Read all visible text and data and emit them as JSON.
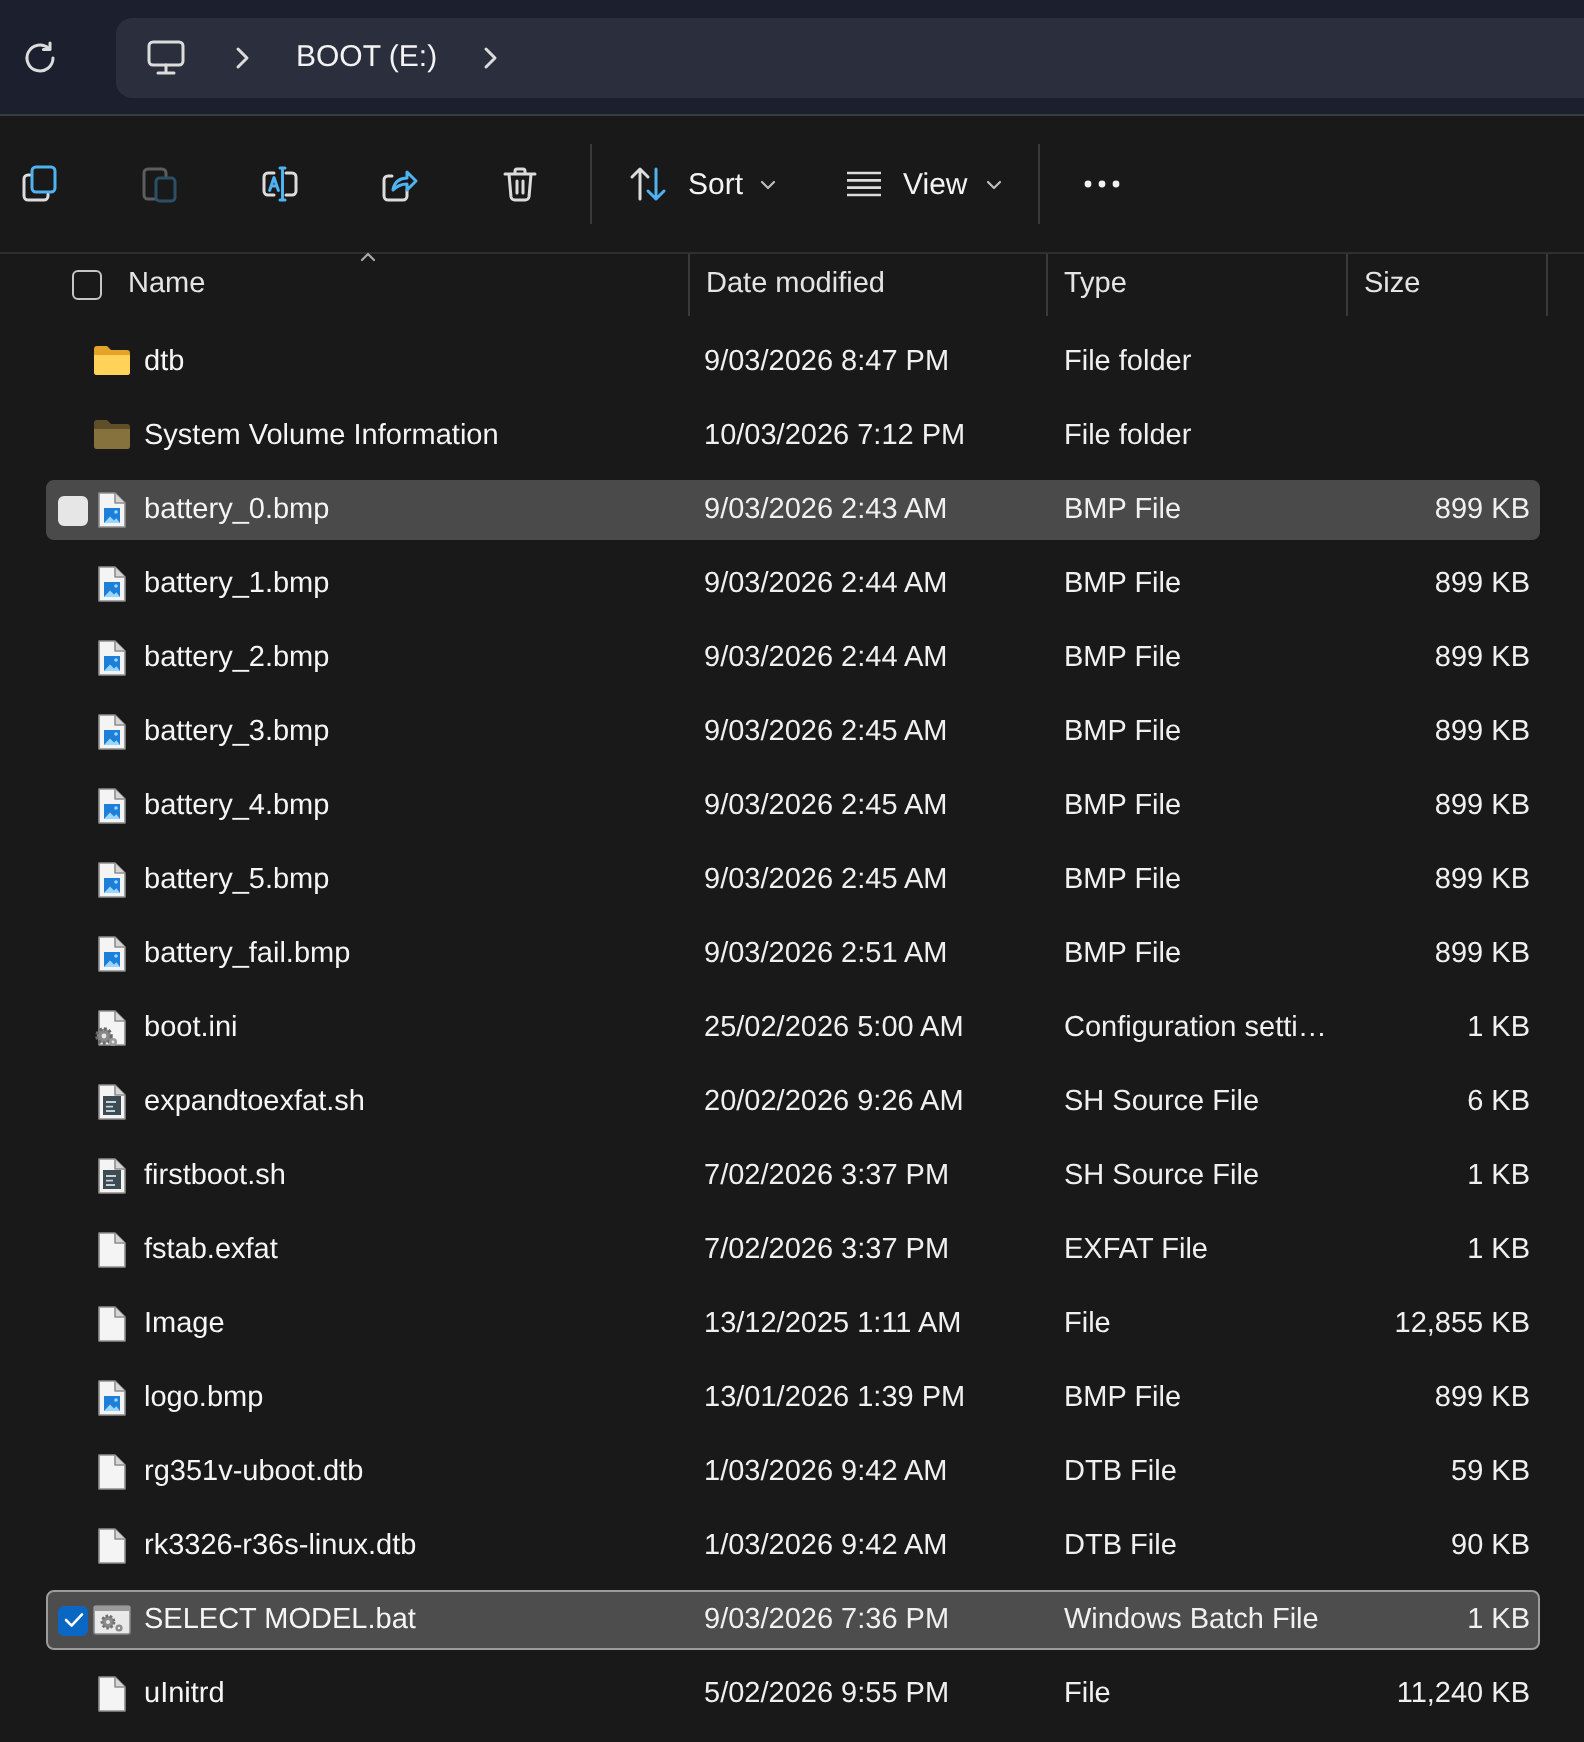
{
  "address_bar": {
    "segments": [
      "BOOT (E:)"
    ]
  },
  "toolbar": {
    "buttons": [
      {
        "kind": "copy",
        "disabled": false
      },
      {
        "kind": "paste",
        "disabled": true
      },
      {
        "kind": "rename",
        "disabled": false
      },
      {
        "kind": "share",
        "disabled": false
      },
      {
        "kind": "delete",
        "disabled": false
      }
    ],
    "menus": [
      {
        "kind": "sort",
        "label": "Sort"
      },
      {
        "kind": "view",
        "label": "View"
      }
    ]
  },
  "file_list": {
    "select_all": {
      "checked": false
    },
    "columns": [
      {
        "label": "Name",
        "sorted": true
      },
      {
        "label": "Date modified",
        "sorted": false
      },
      {
        "label": "Type",
        "sorted": false
      },
      {
        "label": "Size",
        "sorted": false
      }
    ],
    "rows": [
      {
        "kind": "folder",
        "name": "dtb",
        "date_modified": "9/03/2026 8:47 PM",
        "type": "File folder",
        "selected": false,
        "hovered": false
      },
      {
        "kind": "hidden-folder",
        "name": "System Volume Information",
        "date_modified": "10/03/2026 7:12 PM",
        "type": "File folder",
        "selected": false,
        "hovered": false
      },
      {
        "kind": "image",
        "name": "battery_0.bmp",
        "date_modified": "9/03/2026 2:43 AM",
        "type": "BMP File",
        "size": "899 KB",
        "selected": false,
        "hovered": true
      },
      {
        "kind": "image",
        "name": "battery_1.bmp",
        "date_modified": "9/03/2026 2:44 AM",
        "type": "BMP File",
        "size": "899 KB",
        "selected": false,
        "hovered": false
      },
      {
        "kind": "image",
        "name": "battery_2.bmp",
        "date_modified": "9/03/2026 2:44 AM",
        "type": "BMP File",
        "size": "899 KB",
        "selected": false,
        "hovered": false
      },
      {
        "kind": "image",
        "name": "battery_3.bmp",
        "date_modified": "9/03/2026 2:45 AM",
        "type": "BMP File",
        "size": "899 KB",
        "selected": false,
        "hovered": false
      },
      {
        "kind": "image",
        "name": "battery_4.bmp",
        "date_modified": "9/03/2026 2:45 AM",
        "type": "BMP File",
        "size": "899 KB",
        "selected": false,
        "hovered": false
      },
      {
        "kind": "image",
        "name": "battery_5.bmp",
        "date_modified": "9/03/2026 2:45 AM",
        "type": "BMP File",
        "size": "899 KB",
        "selected": false,
        "hovered": false
      },
      {
        "kind": "image",
        "name": "battery_fail.bmp",
        "date_modified": "9/03/2026 2:51 AM",
        "type": "BMP File",
        "size": "899 KB",
        "selected": false,
        "hovered": false
      },
      {
        "kind": "settings",
        "name": "boot.ini",
        "date_modified": "25/02/2026 5:00 AM",
        "type": "Configuration setti…",
        "size": "1 KB",
        "selected": false,
        "hovered": false
      },
      {
        "kind": "script",
        "name": "expandtoexfat.sh",
        "date_modified": "20/02/2026 9:26 AM",
        "type": "SH Source File",
        "size": "6 KB",
        "selected": false,
        "hovered": false
      },
      {
        "kind": "script",
        "name": "firstboot.sh",
        "date_modified": "7/02/2026 3:37 PM",
        "type": "SH Source File",
        "size": "1 KB",
        "selected": false,
        "hovered": false
      },
      {
        "kind": "file",
        "name": "fstab.exfat",
        "date_modified": "7/02/2026 3:37 PM",
        "type": "EXFAT File",
        "size": "1 KB",
        "selected": false,
        "hovered": false
      },
      {
        "kind": "file",
        "name": "Image",
        "date_modified": "13/12/2025 1:11 AM",
        "type": "File",
        "size": "12,855 KB",
        "selected": false,
        "hovered": false
      },
      {
        "kind": "image",
        "name": "logo.bmp",
        "date_modified": "13/01/2026 1:39 PM",
        "type": "BMP File",
        "size": "899 KB",
        "selected": false,
        "hovered": false
      },
      {
        "kind": "file",
        "name": "rg351v-uboot.dtb",
        "date_modified": "1/03/2026 9:42 AM",
        "type": "DTB File",
        "size": "59 KB",
        "selected": false,
        "hovered": false
      },
      {
        "kind": "file",
        "name": "rk3326-r36s-linux.dtb",
        "date_modified": "1/03/2026 9:42 AM",
        "type": "DTB File",
        "size": "90 KB",
        "selected": false,
        "hovered": false
      },
      {
        "kind": "batch",
        "name": "SELECT MODEL.bat",
        "date_modified": "9/03/2026 7:36 PM",
        "type": "Windows Batch File",
        "size": "1 KB",
        "selected": true,
        "hovered": false
      },
      {
        "kind": "file",
        "name": "uInitrd",
        "date_modified": "5/02/2026 9:55 PM",
        "type": "File",
        "size": "11,240 KB",
        "selected": false,
        "hovered": false
      }
    ]
  }
}
